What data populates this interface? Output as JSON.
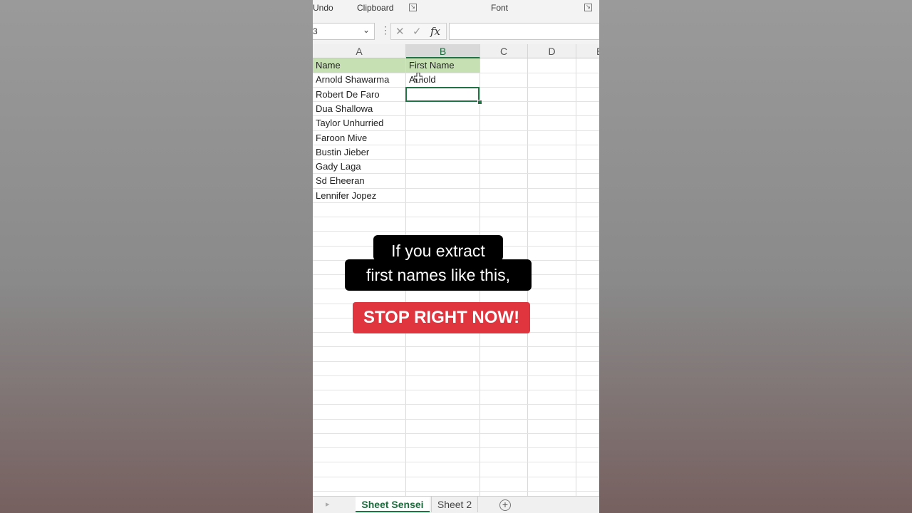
{
  "ribbon": {
    "undo_label": "Undo",
    "clipboard_label": "Clipboard",
    "font_label": "Font",
    "launcher_glyph": "↘"
  },
  "formula_bar": {
    "name_box": "3",
    "chevron_glyph": "⌄",
    "dots_glyph": "⋮",
    "cancel_glyph": "✕",
    "enter_glyph": "✓",
    "fx_label": "fx",
    "value": ""
  },
  "columns": [
    "A",
    "B",
    "C",
    "D",
    "E"
  ],
  "selected_column": "B",
  "sheet": {
    "headers": [
      "Name",
      "First Name"
    ],
    "names": [
      "Arnold Shawarma",
      "Robert De Faro",
      "Dua Shallowa",
      "Taylor Unhurried",
      "Faroon Mive",
      "Bustin Jieber",
      "Gady Laga",
      "Sd Eheeran",
      "Lennifer Jopez"
    ],
    "first_names": [
      "Arnold"
    ],
    "header_fill": "#c6e0b4",
    "accent": "#217346"
  },
  "tabs": {
    "nav_glyph": "▸",
    "items": [
      "Sheet Sensei",
      "Sheet 2"
    ],
    "active": "Sheet Sensei",
    "add_glyph": "+"
  },
  "caption": {
    "line1": "If you extract",
    "line2": "first names like this,",
    "stop_text": "STOP RIGHT NOW!",
    "stop_color": "#e0343f"
  }
}
